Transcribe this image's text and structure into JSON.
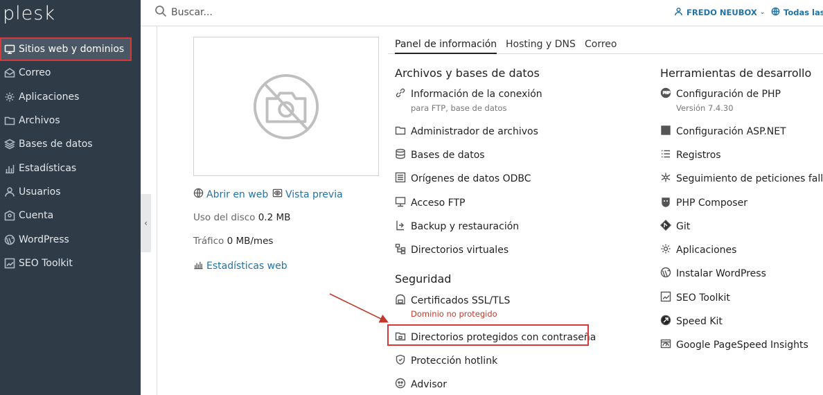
{
  "sidebar": {
    "logo": "plesk",
    "items": [
      {
        "label": "Sitios web y dominios",
        "icon": "monitor-icon"
      },
      {
        "label": "Correo",
        "icon": "envelope-icon"
      },
      {
        "label": "Aplicaciones",
        "icon": "gear-icon"
      },
      {
        "label": "Archivos",
        "icon": "folder-icon"
      },
      {
        "label": "Bases de datos",
        "icon": "layers-icon"
      },
      {
        "label": "Estadísticas",
        "icon": "bar-chart-icon"
      },
      {
        "label": "Usuarios",
        "icon": "user-icon"
      },
      {
        "label": "Cuenta",
        "icon": "account-icon"
      },
      {
        "label": "WordPress",
        "icon": "wordpress-icon"
      },
      {
        "label": "SEO Toolkit",
        "icon": "seo-icon"
      }
    ]
  },
  "header": {
    "search_placeholder": "Buscar...",
    "user": "FREDO NEUBOX",
    "subscriptions": "Todas las s"
  },
  "site": {
    "open_web": "Abrir en web",
    "preview": "Vista previa",
    "disk_label": "Uso del disco",
    "disk_value": "0.2 MB",
    "traffic_label": "Tráfico",
    "traffic_value": "0 MB/mes",
    "stats_web": "Estadísticas web"
  },
  "tabs": [
    "Panel de información",
    "Hosting y DNS",
    "Correo"
  ],
  "files_section": {
    "title": "Archivos y bases de datos",
    "items": [
      {
        "label": "Información de la conexión",
        "sub": "para FTP, base de datos"
      },
      {
        "label": "Administrador de archivos"
      },
      {
        "label": "Bases de datos"
      },
      {
        "label": "Orígenes de datos ODBC"
      },
      {
        "label": "Acceso FTP"
      },
      {
        "label": "Backup y restauración"
      },
      {
        "label": "Directorios virtuales"
      }
    ]
  },
  "security_section": {
    "title": "Seguridad",
    "items": [
      {
        "label": "Certificados SSL/TLS",
        "sub": "Dominio no protegido"
      },
      {
        "label": "Directorios protegidos con contraseña"
      },
      {
        "label": "Protección hotlink"
      },
      {
        "label": "Advisor"
      }
    ]
  },
  "dev_section": {
    "title": "Herramientas de desarrollo",
    "items": [
      {
        "label": "Configuración de PHP",
        "sub": "Versión 7.4.30"
      },
      {
        "label": "Configuración ASP.NET"
      },
      {
        "label": "Registros"
      },
      {
        "label": "Seguimiento de peticiones fallidas"
      },
      {
        "label": "PHP Composer"
      },
      {
        "label": "Git"
      },
      {
        "label": "Aplicaciones"
      },
      {
        "label": "Instalar WordPress"
      },
      {
        "label": "SEO Toolkit"
      },
      {
        "label": "Speed Kit"
      },
      {
        "label": "Google PageSpeed Insights"
      }
    ]
  },
  "colors": {
    "sidebar_bg": "#2f3b47",
    "link": "#2472a4",
    "highlight": "#d9383a",
    "warning_text": "#c0392b"
  }
}
